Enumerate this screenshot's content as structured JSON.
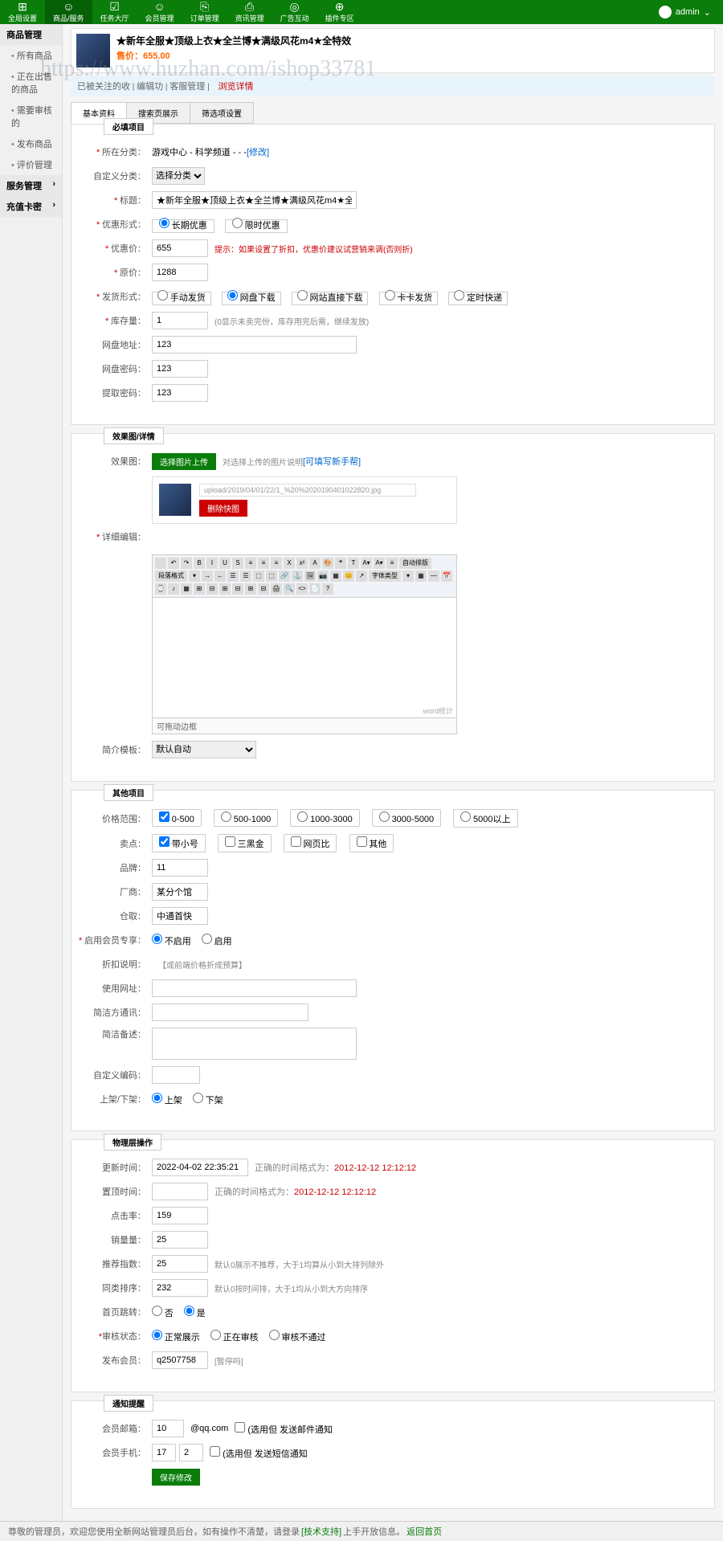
{
  "watermark": "https://www.huzhan.com/ishop33781",
  "topnav": [
    {
      "icon": "⊞",
      "label": "全局设置"
    },
    {
      "icon": "☺",
      "label": "商品/服务"
    },
    {
      "icon": "☑",
      "label": "任务大厅"
    },
    {
      "icon": "☺",
      "label": "会员管理"
    },
    {
      "icon": "⎘",
      "label": "订单管理"
    },
    {
      "icon": "⎙",
      "label": "资讯管理"
    },
    {
      "icon": "◎",
      "label": "广告互动"
    },
    {
      "icon": "⊕",
      "label": "插件专区"
    }
  ],
  "user": {
    "name": "admin"
  },
  "sidebar": {
    "groups": [
      {
        "title": "商品管理",
        "items": [
          "所有商品",
          "正在出售的商品",
          "需要审核的",
          "发布商品",
          "评价管理"
        ]
      },
      {
        "title": "服务管理",
        "items": []
      },
      {
        "title": "充值卡密",
        "items": []
      }
    ]
  },
  "product": {
    "title": "★新年全服★顶级上衣★全兰博★满级风花m4★全特效",
    "price_label": "售价：",
    "price": "655.00",
    "status_links": [
      "已被关注的收",
      "编辑功",
      "客服管理"
    ],
    "status_current": "浏览详情"
  },
  "tabs": {
    "items": [
      "基本资料",
      "搜索页展示",
      "筛选项设置"
    ],
    "active": 0
  },
  "fields": {
    "category": {
      "label": "所在分类",
      "value": "游戏中心 - 科学频道 - - -",
      "action": "[修改]"
    },
    "custom_cat": {
      "label": "自定义分类",
      "value": "选择分类"
    },
    "title": {
      "label": "标题",
      "value": "★新年全服★顶级上衣★全兰博★满级风花m4★全特效"
    },
    "discount_type": {
      "label": "优惠形式",
      "opts": [
        "长期优惠",
        "限时优惠"
      ]
    },
    "discount_price": {
      "label": "优惠价",
      "value": "655",
      "hint": "提示：如果设置了折扣，优惠价建议试营销来调(否则折)"
    },
    "orig_price": {
      "label": "原价",
      "value": "1288"
    },
    "ship_type": {
      "label": "发货形式",
      "opts": [
        "手动发货",
        "网盘下载",
        "网站直接下载",
        "卡卡发货",
        "定时快递"
      ]
    },
    "stock": {
      "label": "库存量",
      "value": "1",
      "hint": "(0显示未卖完份，库存用完后需，继续发放)"
    },
    "netdisk": {
      "label": "网盘地址",
      "value": "123"
    },
    "netdisk_code": {
      "label": "网盘密码",
      "value": "123"
    },
    "extract_code": {
      "label": "提取密码",
      "value": "123"
    }
  },
  "section_titles": {
    "basic": "必填项目",
    "image": "效果图/详情",
    "other": "其他项目",
    "manage": "物理层操作",
    "notify": "通知提醒"
  },
  "image": {
    "label": "效果图",
    "btn": "选择图片上传",
    "hint": "对选择上传的图片说明",
    "hint_link": "[可填写新手帮]",
    "path": "upload/2019/04/01/22/1_%20%2020190401022820.jpg",
    "delete": "删除快图"
  },
  "detail": {
    "label": "详细编辑",
    "footer": "可拖动边框",
    "status": "word统计"
  },
  "template": {
    "label": "简介模板",
    "value": "默认自动"
  },
  "price_range": {
    "label": "价格范围",
    "opts": [
      "0-500",
      "500-1000",
      "1000-3000",
      "3000-5000",
      "5000以上"
    ]
  },
  "sell_point": {
    "label": "卖点",
    "opts": [
      "带小号",
      "三黑金",
      "网页比",
      "其他"
    ]
  },
  "brand": {
    "label": "品牌",
    "value": "11"
  },
  "maker": {
    "label": "厂商",
    "value": "某分个馆"
  },
  "origin": {
    "label": "仓取",
    "value": "中通首快"
  },
  "member_price": {
    "label": "启用会员专享",
    "opts": [
      "不启用",
      "启用"
    ]
  },
  "member_discount": {
    "label": "折扣说明",
    "hint": "【或前端价格折成预算】"
  },
  "custom_url": {
    "label": "使用网址"
  },
  "traffic_tip": {
    "label": "简洁方通讯"
  },
  "summary": {
    "label": "简洁备述"
  },
  "custom_code": {
    "label": "自定义编码"
  },
  "onoff": {
    "label": "上架/下架",
    "opts": [
      "上架",
      "下架"
    ]
  },
  "update_time": {
    "label": "更新时间",
    "value": "2022-04-02 22:35:21",
    "hint": "正确的时间格式为：",
    "example": "2012-12-12 12:12:12"
  },
  "top_time": {
    "label": "置顶时间",
    "hint": "正确的时间格式为：",
    "example": "2012-12-12 12:12:12"
  },
  "score": {
    "label": "点击率",
    "value": "159"
  },
  "sold": {
    "label": "销量量",
    "value": "25"
  },
  "recommend": {
    "label": "推荐指数",
    "value": "25",
    "hint": "默认0展示不推荐，大于1均算从小到大排列除外"
  },
  "sort": {
    "label": "同类排序",
    "value": "232",
    "hint": "默认0按时间排，大于1均从小到大方向排序"
  },
  "home_redirect": {
    "label": "首页跳转",
    "opts": [
      "否",
      "是"
    ]
  },
  "audit": {
    "label": "审核状态",
    "opts": [
      "正常展示",
      "正在审核",
      "审核不通过"
    ]
  },
  "publisher": {
    "label": "发布会员",
    "value": "q2507758",
    "hint": "[暂停吗]"
  },
  "email": {
    "label": "会员邮箱",
    "value": "10",
    "suffix": "@qq.com",
    "opt": "(选用但 发送邮件通知"
  },
  "phone": {
    "label": "会员手机",
    "value": "17",
    "value2": "2",
    "opt": "(选用但 发送短信通知"
  },
  "submit": "保存修改",
  "footer": {
    "text": "尊敬的管理员，欢迎您使用全新网站管理员后台，如有操作不清楚，请登录",
    "link1": "[技术支持]",
    "text2": "上手开放信息。",
    "back": "返回首页"
  }
}
